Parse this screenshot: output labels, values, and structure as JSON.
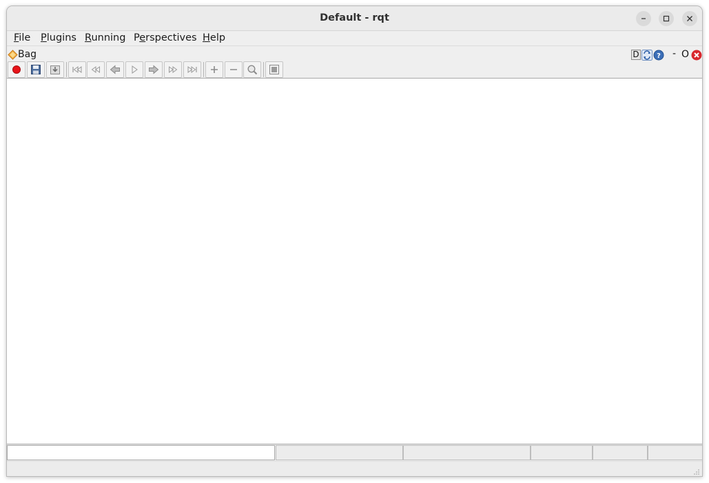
{
  "window": {
    "title": "Default - rqt"
  },
  "menubar": {
    "items": [
      {
        "mnemonic": "F",
        "rest": "ile"
      },
      {
        "mnemonic": "P",
        "rest": "lugins"
      },
      {
        "mnemonic": "R",
        "rest": "unning"
      },
      {
        "lead": "P",
        "mnemonic": "e",
        "rest": "rspectives"
      },
      {
        "mnemonic": "H",
        "rest": "elp"
      }
    ]
  },
  "plugin": {
    "title": "Bag",
    "controls": {
      "dock_label": "D",
      "minimize_label": "-",
      "float_label": "O"
    }
  },
  "toolbar": {
    "icons": [
      "record-icon",
      "save-icon",
      "load-icon",
      "jump-begin-icon",
      "rewind-icon",
      "prev-icon",
      "play-icon",
      "next-icon",
      "fast-forward-icon",
      "jump-end-icon",
      "zoom-in-icon",
      "zoom-out-icon",
      "zoom-fit-icon",
      "thumbnails-icon"
    ]
  },
  "status": {
    "cells": [
      "",
      "",
      "",
      "",
      "",
      ""
    ]
  },
  "colors": {
    "record": "#e8141a",
    "close": "#d8282e",
    "help": "#3c6fb8"
  }
}
